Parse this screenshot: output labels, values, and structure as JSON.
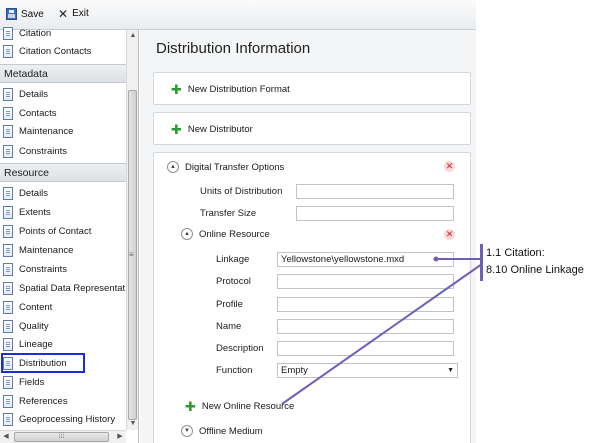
{
  "toolbar": {
    "save_label": "Save",
    "exit_label": "Exit"
  },
  "sidebar": {
    "top_items": [
      "Citation",
      "Citation Contacts"
    ],
    "sections": [
      {
        "title": "Metadata",
        "items": [
          "Details",
          "Contacts",
          "Maintenance",
          "Constraints"
        ]
      },
      {
        "title": "Resource",
        "items": [
          "Details",
          "Extents",
          "Points of Contact",
          "Maintenance",
          "Constraints",
          "Spatial Data Representat",
          "Content",
          "Quality",
          "Lineage",
          "Distribution",
          "Fields",
          "References",
          "Geoprocessing History"
        ]
      }
    ],
    "selected_item": "Distribution"
  },
  "main": {
    "title": "Distribution Information",
    "new_distribution_format": "New Distribution Format",
    "new_distributor": "New Distributor",
    "digital_transfer": {
      "title": "Digital Transfer Options",
      "units_label": "Units of Distribution",
      "units_value": "",
      "transfer_size_label": "Transfer Size",
      "transfer_size_value": "",
      "online_resource": {
        "title": "Online Resource",
        "fields": [
          {
            "label": "Linkage",
            "value": "Yellowstone\\yellowstone.mxd"
          },
          {
            "label": "Protocol",
            "value": ""
          },
          {
            "label": "Profile",
            "value": ""
          },
          {
            "label": "Name",
            "value": ""
          },
          {
            "label": "Description",
            "value": ""
          }
        ],
        "function_label": "Function",
        "function_value": "Empty"
      },
      "new_online_resource": "New Online Resource",
      "offline_medium": "Offline Medium"
    }
  },
  "callout": {
    "line1": "1.1 Citation:",
    "line2": "8.10 Online Linkage",
    "color": "#6b61b8"
  },
  "colors": {
    "selection_border": "#1f2bd6",
    "add_green": "#2e9a2e",
    "delete_red": "#d02020"
  },
  "icons": [
    "save-icon",
    "exit-icon",
    "document-icon",
    "plus-icon",
    "collapse-icon",
    "delete-icon",
    "dropdown-arrow-icon"
  ]
}
